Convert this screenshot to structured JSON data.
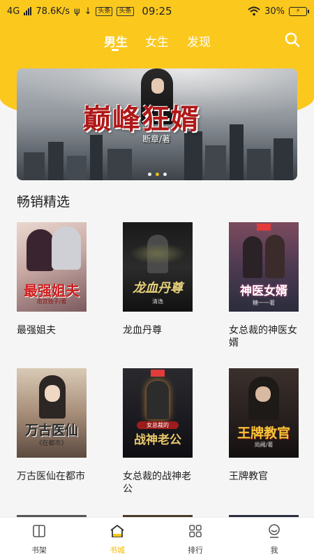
{
  "status_bar": {
    "network": "4G",
    "speed": "78.6K/s",
    "badge1": "头条",
    "badge2": "头条",
    "time": "09:25",
    "battery": "30%"
  },
  "top_nav": {
    "tabs": [
      {
        "label": "男生"
      },
      {
        "label": "女生"
      },
      {
        "label": "发现"
      }
    ],
    "search_icon": "search-icon"
  },
  "banner": {
    "title": "巅峰狂婿",
    "author": "断章/著"
  },
  "section": {
    "title": "畅销精选"
  },
  "books": [
    {
      "title": "最强姐夫",
      "cover_text": "最强姐夫",
      "cover_sub": "南宫独子/著"
    },
    {
      "title": "龙血丹尊",
      "cover_text": "龙血丹尊",
      "cover_sub": "清逸"
    },
    {
      "title": "女总裁的神医女婿",
      "cover_text": "神医女婿",
      "cover_sub": "糖一一著"
    },
    {
      "title": "万古医仙在都市",
      "cover_text": "万古医仙",
      "cover_sub": "《在都市》"
    },
    {
      "title": "女总裁的战神老公",
      "cover_text": "战神老公",
      "cover_sub": "女总裁的"
    },
    {
      "title": "王牌教官",
      "cover_text": "王牌教官",
      "cover_sub": "尚阙/著"
    }
  ],
  "tabbar": {
    "items": [
      {
        "label": "书架",
        "icon": "bookshelf-icon"
      },
      {
        "label": "书城",
        "icon": "bookstore-icon"
      },
      {
        "label": "排行",
        "icon": "ranking-icon"
      },
      {
        "label": "我",
        "icon": "profile-icon"
      }
    ],
    "active_color": "#f5b800"
  },
  "colors": {
    "accent": "#fbc81e"
  }
}
